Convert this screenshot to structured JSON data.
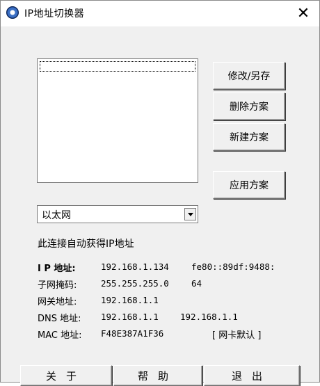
{
  "window": {
    "title": "IP地址切换器",
    "close_glyph": "✕"
  },
  "side_buttons": {
    "modify_save": "修改/另存",
    "delete_scheme": "删除方案",
    "new_scheme": "新建方案",
    "apply_scheme": "应用方案"
  },
  "adapter": {
    "selected": "以太网"
  },
  "status_text": "此连接自动获得IP地址",
  "info": {
    "ip_label": "I P 地址:",
    "ip_v4": "192.168.1.134",
    "ip_v6": "fe80::89df:9488:",
    "mask_label": "子网掩码:",
    "mask_value": "255.255.255.0",
    "mask_prefix": "64",
    "gateway_label": "网关地址:",
    "gateway_value": "192.168.1.1",
    "dns_label": "DNS 地址:",
    "dns_primary": "192.168.1.1",
    "dns_secondary": "192.168.1.1",
    "mac_label": "MAC 地址:",
    "mac_value": "F48E387A1F36",
    "mac_default_link": "[ 网卡默认 ]"
  },
  "bottom_buttons": {
    "about": "关于",
    "help": "帮助",
    "exit": "退出"
  }
}
